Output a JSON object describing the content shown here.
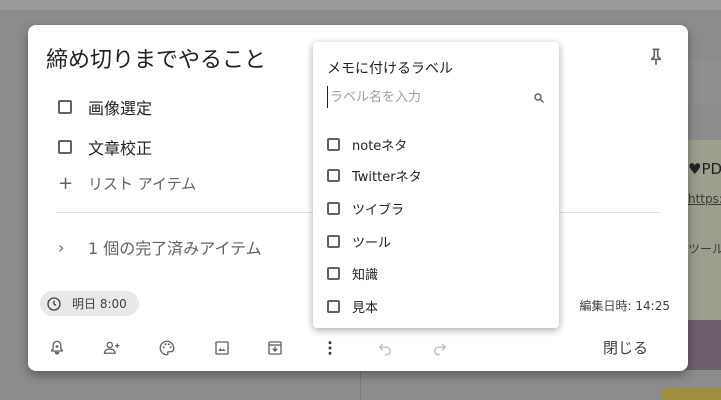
{
  "note": {
    "title": "締め切りまでやること",
    "items": [
      {
        "label": "画像選定",
        "checked": false
      },
      {
        "label": "文章校正",
        "checked": false
      }
    ],
    "add_item_label": "リスト アイテム",
    "completed_label": "1 個の完了済みアイテム",
    "reminder": "明日 8:00",
    "edited": "編集日時: 14:25",
    "close_label": "閉じる"
  },
  "label_menu": {
    "title": "メモに付けるラベル",
    "search_placeholder": "ラベル名を入力",
    "labels": [
      {
        "name": "noteネタ",
        "checked": false
      },
      {
        "name": "Twitterネタ",
        "checked": false
      },
      {
        "name": "ツイブラ",
        "checked": false
      },
      {
        "name": "ツール",
        "checked": false
      },
      {
        "name": "知識",
        "checked": false
      },
      {
        "name": "見本",
        "checked": false
      }
    ]
  },
  "background": {
    "snippets": [
      "♥PD",
      "https:",
      "ツール"
    ]
  },
  "icons": [
    "pin-icon",
    "clock-icon",
    "add-alert-icon",
    "collaborator-icon",
    "palette-icon",
    "image-icon",
    "archive-icon",
    "more-icon",
    "undo-icon",
    "redo-icon",
    "search-icon"
  ],
  "colors": {
    "surface": "#ffffff",
    "chip": "#e8e8e8",
    "text": "#202124",
    "muted": "#5f6368",
    "disabled": "#bdbdbd"
  }
}
